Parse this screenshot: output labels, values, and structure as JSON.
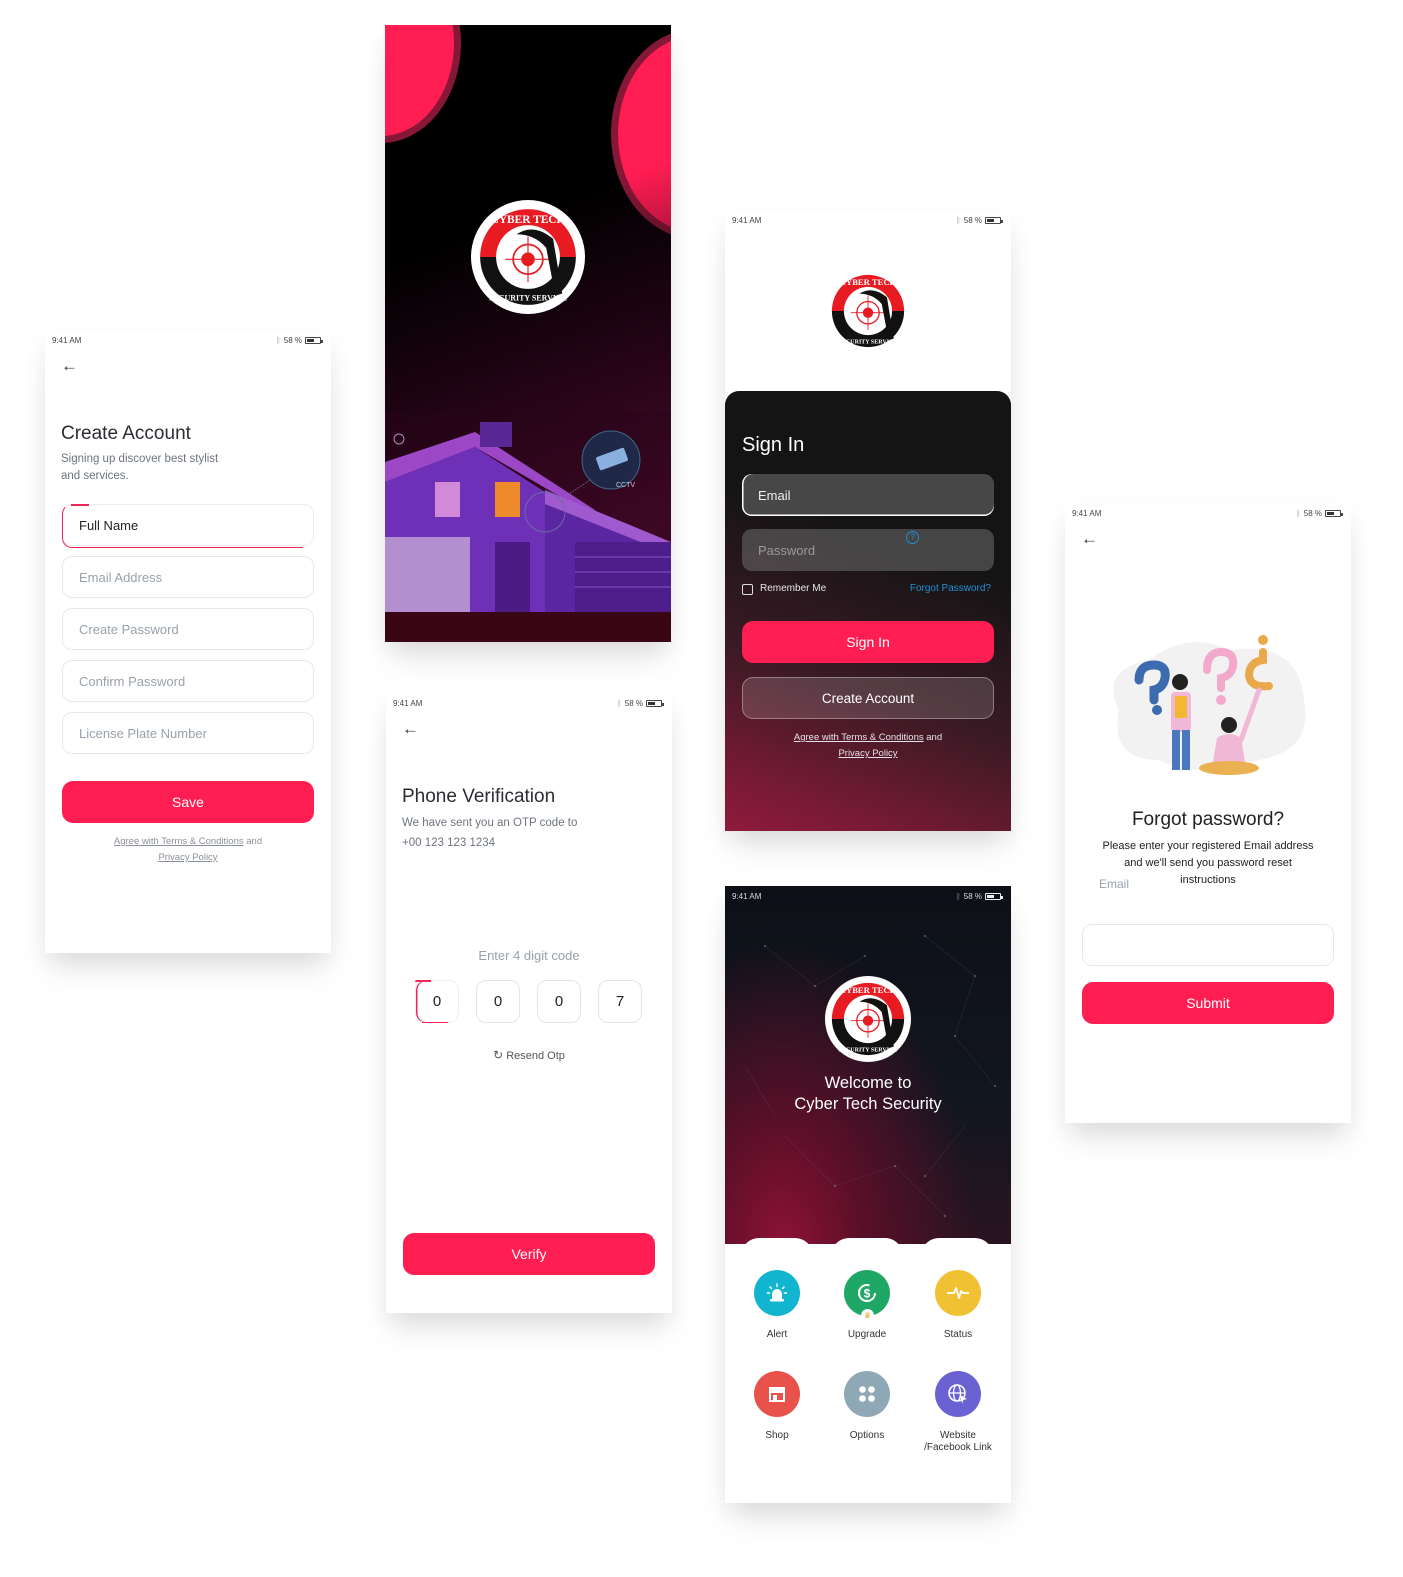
{
  "status_bar": {
    "time": "9:41 AM",
    "battery": "58 %"
  },
  "brand": {
    "name_top": "CYBER TECH",
    "name_bottom": "SECURITY SERVICE",
    "primary_color": "#ff1d52",
    "dark_color": "#141414"
  },
  "splash": {
    "cctv_label": "CCTV"
  },
  "create_account": {
    "title": "Create Account",
    "subtitle_line1": "Signing up discover best stylist",
    "subtitle_line2": "and services.",
    "fields": [
      {
        "name": "full-name",
        "value": "Full Name",
        "active": true
      },
      {
        "name": "email-address",
        "placeholder": "Email Address"
      },
      {
        "name": "create-password",
        "placeholder": "Create Password"
      },
      {
        "name": "confirm-password",
        "placeholder": "Confirm Password"
      },
      {
        "name": "license-plate",
        "placeholder": "License Plate Number"
      }
    ],
    "save_label": "Save",
    "terms_link": "Agree with Terms & Conditions",
    "terms_and": " and",
    "privacy_link": "Privacy Policy"
  },
  "sign_in": {
    "title": "Sign In",
    "email_value": "Email",
    "password_placeholder": "Password",
    "help_glyph": "?",
    "remember_label": "Remember Me",
    "forgot_link": "Forgot Password?",
    "sign_in_label": "Sign In",
    "create_account_label": "Create Account",
    "terms_link": "Agree with Terms & Conditions",
    "terms_and": " and",
    "privacy_link": "Privacy Policy"
  },
  "phone_verification": {
    "title": "Phone Verification",
    "subtitle": "We have sent you an OTP code to",
    "phone": "+00 123 123 1234",
    "code_label": "Enter 4 digit code",
    "digits": [
      "0",
      "0",
      "0",
      "7"
    ],
    "resend_label": "Resend Otp",
    "verify_label": "Verify"
  },
  "dashboard": {
    "welcome_line1": "Welcome to",
    "welcome_line2": "Cyber Tech Security",
    "tiles": [
      {
        "label": "Alert",
        "icon": "alarm-siren-icon",
        "color": "#12b5cf"
      },
      {
        "label": "Upgrade",
        "icon": "dollar-refresh-icon",
        "color": "#1fa865",
        "badge": "crown-icon"
      },
      {
        "label": "Status",
        "icon": "pulse-icon",
        "color": "#f0c233"
      },
      {
        "label": "Shop",
        "icon": "storefront-icon",
        "color": "#e8524a"
      },
      {
        "label": "Options",
        "icon": "four-dots-icon",
        "color": "#8fa8b5"
      },
      {
        "label": "Website",
        "label2": "/Facebook Link",
        "icon": "globe-cursor-icon",
        "color": "#6a62d3"
      }
    ]
  },
  "forgot_password": {
    "title": "Forgot password?",
    "line1": "Please enter your registered Email address",
    "line2": "and we'll send you password reset",
    "line3": "instructions",
    "email_label": "Email",
    "email_value": "",
    "submit_label": "Submit"
  }
}
